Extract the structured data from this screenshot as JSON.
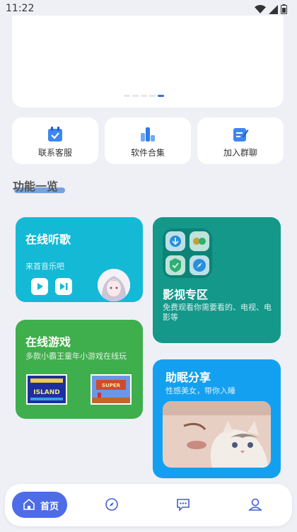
{
  "status_bar": {
    "time": "11:22"
  },
  "banner": {
    "pages": 5,
    "active_page": 5
  },
  "shortcuts": [
    {
      "label": "联系客服",
      "icon": "calendar-check-icon"
    },
    {
      "label": "软件合集",
      "icon": "bar-chart-icon"
    },
    {
      "label": "加入群聊",
      "icon": "edit-note-icon"
    }
  ],
  "section": {
    "title": "功能一览"
  },
  "features": {
    "music": {
      "title": "在线听歌",
      "subtitle": "来首音乐吧"
    },
    "video": {
      "title": "影视专区",
      "subtitle": "免费观看你需要看的、电视、电影等"
    },
    "game": {
      "title": "在线游戏",
      "subtitle": "多款小霸王童年小游戏在线玩"
    },
    "sleep": {
      "title": "助眠分享",
      "subtitle": "性感美女，带你入睡"
    }
  },
  "game_thumbs": [
    {
      "caption": "ISLAND"
    },
    {
      "caption": "SUPER"
    }
  ],
  "nav": {
    "home": "首页",
    "items": [
      "compass-icon",
      "chat-icon",
      "profile-icon"
    ]
  },
  "colors": {
    "accent": "#4e6be8",
    "music": "#14b9d6",
    "video": "#13988a",
    "game": "#3fae4c",
    "sleep": "#14a0f0"
  }
}
